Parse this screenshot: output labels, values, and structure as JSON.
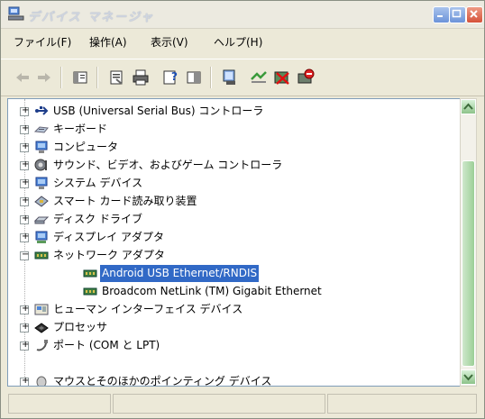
{
  "window": {
    "title": "デバイス マネージャ",
    "accent": "#3169c6"
  },
  "menu": [
    {
      "label": "ファイル(F)"
    },
    {
      "label": "操作(A)"
    },
    {
      "label": "表示(V)"
    },
    {
      "label": "ヘルプ(H)"
    }
  ],
  "toolbar": {
    "icons": [
      "back-arrow-icon",
      "forward-arrow-icon",
      "tree-view-icon",
      "properties-icon",
      "print-icon",
      "help-icon",
      "console-icon",
      "scan-hardware-icon",
      "update-driver-icon",
      "uninstall-icon",
      "disable-device-icon"
    ]
  },
  "tree": {
    "items": [
      {
        "label": "USB (Universal Serial Bus) コントローラ",
        "expander": "+",
        "icon": "usb-icon"
      },
      {
        "label": "キーボード",
        "expander": "+",
        "icon": "keyboard-icon"
      },
      {
        "label": "コンピュータ",
        "expander": "+",
        "icon": "computer-icon"
      },
      {
        "label": "サウンド、ビデオ、およびゲーム コントローラ",
        "expander": "+",
        "icon": "sound-icon"
      },
      {
        "label": "システム デバイス",
        "expander": "+",
        "icon": "system-device-icon"
      },
      {
        "label": "スマート カード読み取り装置",
        "expander": "+",
        "icon": "smart-card-icon"
      },
      {
        "label": "ディスク ドライブ",
        "expander": "+",
        "icon": "disk-drive-icon"
      },
      {
        "label": "ディスプレイ アダプタ",
        "expander": "+",
        "icon": "display-adapter-icon"
      },
      {
        "label": "ネットワーク アダプタ",
        "expander": "−",
        "icon": "network-adapter-icon"
      },
      {
        "label": "Android USB Ethernet/RNDIS",
        "expander": "",
        "icon": "network-card-icon",
        "selected": true
      },
      {
        "label": "Broadcom NetLink (TM) Gigabit Ethernet",
        "expander": "",
        "icon": "network-card-icon"
      },
      {
        "label": "ヒューマン インターフェイス デバイス",
        "expander": "+",
        "icon": "hid-icon"
      },
      {
        "label": "プロセッサ",
        "expander": "+",
        "icon": "processor-icon"
      },
      {
        "label": "ポート (COM と LPT)",
        "expander": "+",
        "icon": "port-icon"
      },
      {
        "label": "マウスとそのほかのポインティング デバイス",
        "expander": "+",
        "icon": "mouse-icon"
      }
    ]
  }
}
